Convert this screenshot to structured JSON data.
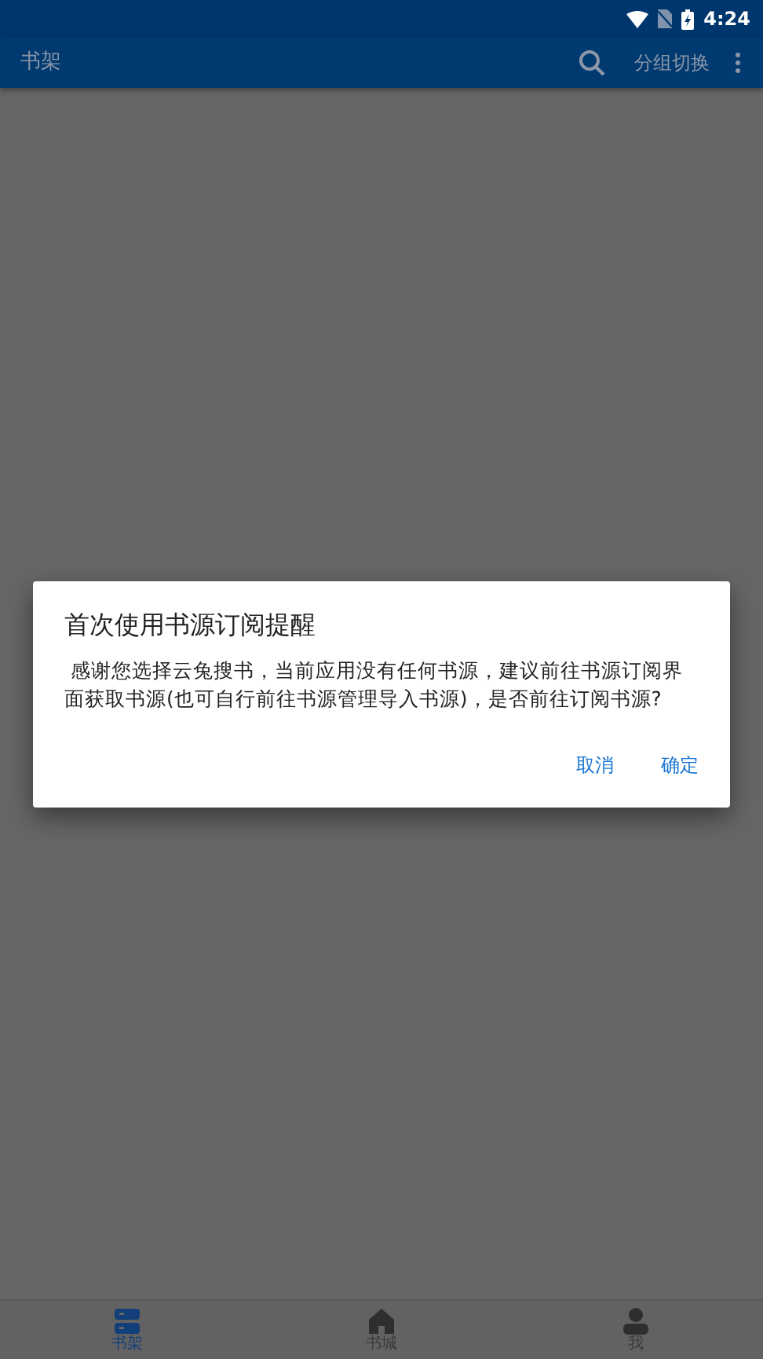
{
  "status_bar": {
    "time": "4:24"
  },
  "app_bar": {
    "title": "书架",
    "group_switch": "分组切换"
  },
  "dialog": {
    "title": "首次使用书源订阅提醒",
    "message": " 感谢您选择云兔搜书，当前应用没有任何书源，建议前往书源订阅界面获取书源(也可自行前往书源管理导入书源)，是否前往订阅书源?",
    "buttons": [
      "取消",
      "确定"
    ]
  },
  "bottom_nav": [
    {
      "label": "书架",
      "kind": "shelf",
      "selected": true
    },
    {
      "label": "书城",
      "kind": "store",
      "selected": false
    },
    {
      "label": "我",
      "kind": "me",
      "selected": false
    }
  ]
}
